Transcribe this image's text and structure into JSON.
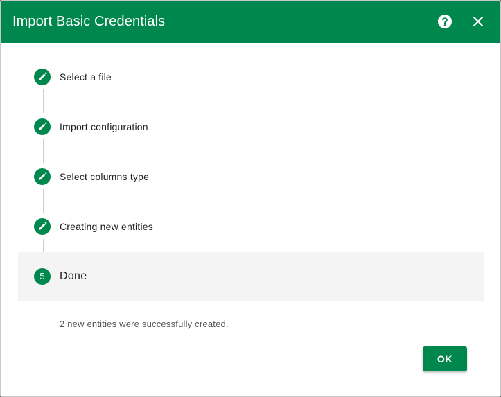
{
  "dialog": {
    "title": "Import Basic Credentials",
    "help_icon": "help-circle-icon",
    "close_icon": "close-icon"
  },
  "steps": [
    {
      "label": "Select a file",
      "status": "completed",
      "icon": "pencil-icon"
    },
    {
      "label": "Import configuration",
      "status": "completed",
      "icon": "pencil-icon"
    },
    {
      "label": "Select columns type",
      "status": "completed",
      "icon": "pencil-icon"
    },
    {
      "label": "Creating new entities",
      "status": "completed",
      "icon": "pencil-icon"
    }
  ],
  "active_step": {
    "number": "5",
    "label": "Done"
  },
  "message": "2 new entities were successfully created.",
  "actions": {
    "ok_label": "OK"
  },
  "colors": {
    "primary": "#00874e",
    "active_step_bg": "#f4f4f4"
  }
}
